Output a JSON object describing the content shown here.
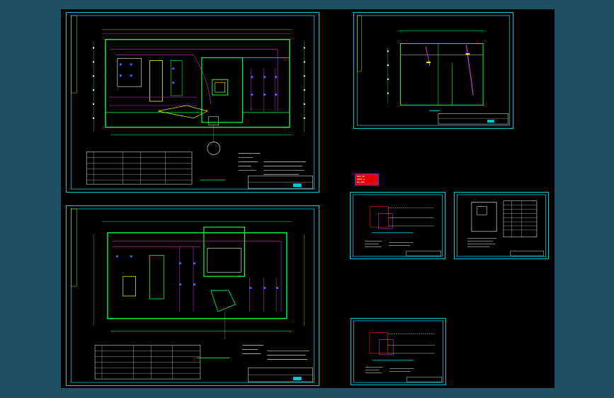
{
  "canvas": {
    "background": "#000000",
    "frame_color": "#00c8d8"
  },
  "colors": {
    "wall": "#00ff40",
    "circuit": "#ff40ff",
    "fixture": "#4060ff",
    "cyan": "#00e0ff",
    "yellow": "#ffff00",
    "red": "#ff2020",
    "white": "#ffffff"
  },
  "sheets": [
    {
      "id": "plan-1",
      "kind": "floor-plan"
    },
    {
      "id": "plan-2",
      "kind": "floor-plan"
    },
    {
      "id": "riser",
      "kind": "elevation"
    },
    {
      "id": "schematic-1",
      "kind": "schematic"
    },
    {
      "id": "schematic-2",
      "kind": "schematic-table"
    },
    {
      "id": "schematic-3",
      "kind": "schematic"
    }
  ],
  "legend_badge": {
    "color": "#e80000"
  }
}
